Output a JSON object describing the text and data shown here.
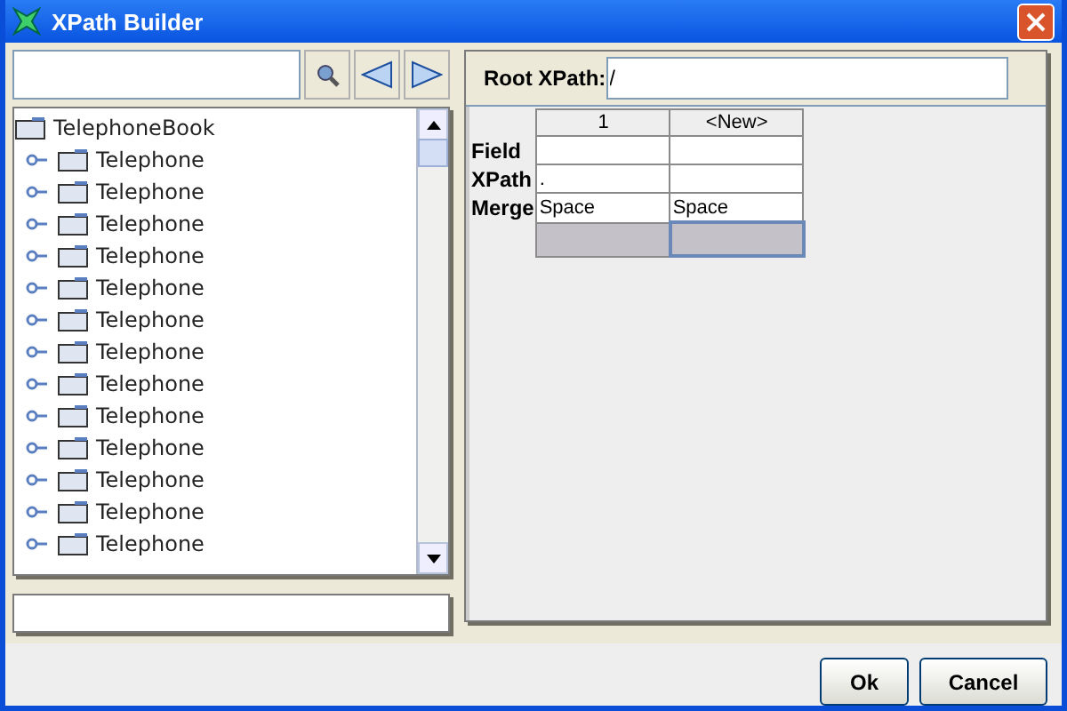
{
  "window": {
    "title": "XPath Builder"
  },
  "tree": {
    "label": "TelephoneBook",
    "children": [
      {
        "label": "Telephone"
      },
      {
        "label": "Telephone"
      },
      {
        "label": "Telephone"
      },
      {
        "label": "Telephone"
      },
      {
        "label": "Telephone"
      },
      {
        "label": "Telephone"
      },
      {
        "label": "Telephone"
      },
      {
        "label": "Telephone"
      },
      {
        "label": "Telephone"
      },
      {
        "label": "Telephone"
      },
      {
        "label": "Telephone"
      },
      {
        "label": "Telephone"
      },
      {
        "label": "Telephone"
      }
    ]
  },
  "root_xpath": {
    "label": "Root XPath:",
    "value": "/"
  },
  "table": {
    "columns": [
      "1",
      "<New>"
    ],
    "rows": [
      {
        "label": "Field",
        "cells": [
          "",
          ""
        ]
      },
      {
        "label": "XPath",
        "cells": [
          ".",
          ""
        ]
      },
      {
        "label": "Merge",
        "cells": [
          "Space",
          "Space"
        ]
      }
    ],
    "footer_selected": [
      false,
      true
    ]
  },
  "buttons": [
    "Ok",
    "Cancel"
  ]
}
